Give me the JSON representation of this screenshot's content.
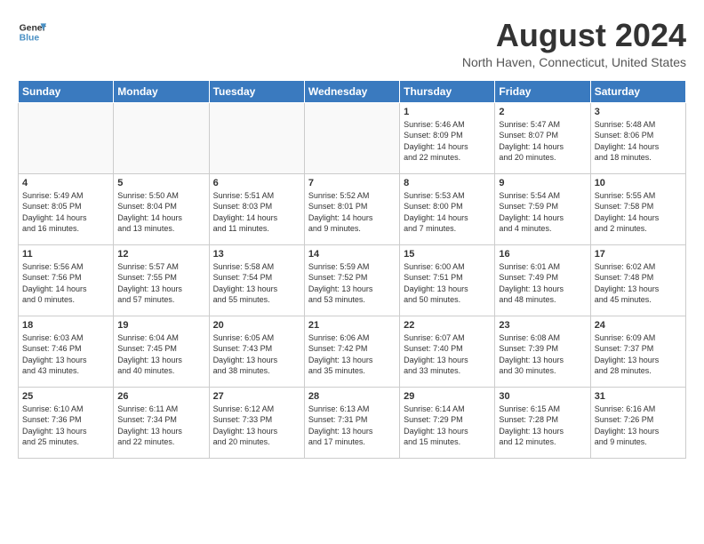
{
  "header": {
    "logo_line1": "General",
    "logo_line2": "Blue",
    "month_year": "August 2024",
    "location": "North Haven, Connecticut, United States"
  },
  "days_of_week": [
    "Sunday",
    "Monday",
    "Tuesday",
    "Wednesday",
    "Thursday",
    "Friday",
    "Saturday"
  ],
  "weeks": [
    [
      {
        "day": "",
        "info": ""
      },
      {
        "day": "",
        "info": ""
      },
      {
        "day": "",
        "info": ""
      },
      {
        "day": "",
        "info": ""
      },
      {
        "day": "1",
        "info": "Sunrise: 5:46 AM\nSunset: 8:09 PM\nDaylight: 14 hours\nand 22 minutes."
      },
      {
        "day": "2",
        "info": "Sunrise: 5:47 AM\nSunset: 8:07 PM\nDaylight: 14 hours\nand 20 minutes."
      },
      {
        "day": "3",
        "info": "Sunrise: 5:48 AM\nSunset: 8:06 PM\nDaylight: 14 hours\nand 18 minutes."
      }
    ],
    [
      {
        "day": "4",
        "info": "Sunrise: 5:49 AM\nSunset: 8:05 PM\nDaylight: 14 hours\nand 16 minutes."
      },
      {
        "day": "5",
        "info": "Sunrise: 5:50 AM\nSunset: 8:04 PM\nDaylight: 14 hours\nand 13 minutes."
      },
      {
        "day": "6",
        "info": "Sunrise: 5:51 AM\nSunset: 8:03 PM\nDaylight: 14 hours\nand 11 minutes."
      },
      {
        "day": "7",
        "info": "Sunrise: 5:52 AM\nSunset: 8:01 PM\nDaylight: 14 hours\nand 9 minutes."
      },
      {
        "day": "8",
        "info": "Sunrise: 5:53 AM\nSunset: 8:00 PM\nDaylight: 14 hours\nand 7 minutes."
      },
      {
        "day": "9",
        "info": "Sunrise: 5:54 AM\nSunset: 7:59 PM\nDaylight: 14 hours\nand 4 minutes."
      },
      {
        "day": "10",
        "info": "Sunrise: 5:55 AM\nSunset: 7:58 PM\nDaylight: 14 hours\nand 2 minutes."
      }
    ],
    [
      {
        "day": "11",
        "info": "Sunrise: 5:56 AM\nSunset: 7:56 PM\nDaylight: 14 hours\nand 0 minutes."
      },
      {
        "day": "12",
        "info": "Sunrise: 5:57 AM\nSunset: 7:55 PM\nDaylight: 13 hours\nand 57 minutes."
      },
      {
        "day": "13",
        "info": "Sunrise: 5:58 AM\nSunset: 7:54 PM\nDaylight: 13 hours\nand 55 minutes."
      },
      {
        "day": "14",
        "info": "Sunrise: 5:59 AM\nSunset: 7:52 PM\nDaylight: 13 hours\nand 53 minutes."
      },
      {
        "day": "15",
        "info": "Sunrise: 6:00 AM\nSunset: 7:51 PM\nDaylight: 13 hours\nand 50 minutes."
      },
      {
        "day": "16",
        "info": "Sunrise: 6:01 AM\nSunset: 7:49 PM\nDaylight: 13 hours\nand 48 minutes."
      },
      {
        "day": "17",
        "info": "Sunrise: 6:02 AM\nSunset: 7:48 PM\nDaylight: 13 hours\nand 45 minutes."
      }
    ],
    [
      {
        "day": "18",
        "info": "Sunrise: 6:03 AM\nSunset: 7:46 PM\nDaylight: 13 hours\nand 43 minutes."
      },
      {
        "day": "19",
        "info": "Sunrise: 6:04 AM\nSunset: 7:45 PM\nDaylight: 13 hours\nand 40 minutes."
      },
      {
        "day": "20",
        "info": "Sunrise: 6:05 AM\nSunset: 7:43 PM\nDaylight: 13 hours\nand 38 minutes."
      },
      {
        "day": "21",
        "info": "Sunrise: 6:06 AM\nSunset: 7:42 PM\nDaylight: 13 hours\nand 35 minutes."
      },
      {
        "day": "22",
        "info": "Sunrise: 6:07 AM\nSunset: 7:40 PM\nDaylight: 13 hours\nand 33 minutes."
      },
      {
        "day": "23",
        "info": "Sunrise: 6:08 AM\nSunset: 7:39 PM\nDaylight: 13 hours\nand 30 minutes."
      },
      {
        "day": "24",
        "info": "Sunrise: 6:09 AM\nSunset: 7:37 PM\nDaylight: 13 hours\nand 28 minutes."
      }
    ],
    [
      {
        "day": "25",
        "info": "Sunrise: 6:10 AM\nSunset: 7:36 PM\nDaylight: 13 hours\nand 25 minutes."
      },
      {
        "day": "26",
        "info": "Sunrise: 6:11 AM\nSunset: 7:34 PM\nDaylight: 13 hours\nand 22 minutes."
      },
      {
        "day": "27",
        "info": "Sunrise: 6:12 AM\nSunset: 7:33 PM\nDaylight: 13 hours\nand 20 minutes."
      },
      {
        "day": "28",
        "info": "Sunrise: 6:13 AM\nSunset: 7:31 PM\nDaylight: 13 hours\nand 17 minutes."
      },
      {
        "day": "29",
        "info": "Sunrise: 6:14 AM\nSunset: 7:29 PM\nDaylight: 13 hours\nand 15 minutes."
      },
      {
        "day": "30",
        "info": "Sunrise: 6:15 AM\nSunset: 7:28 PM\nDaylight: 13 hours\nand 12 minutes."
      },
      {
        "day": "31",
        "info": "Sunrise: 6:16 AM\nSunset: 7:26 PM\nDaylight: 13 hours\nand 9 minutes."
      }
    ]
  ]
}
